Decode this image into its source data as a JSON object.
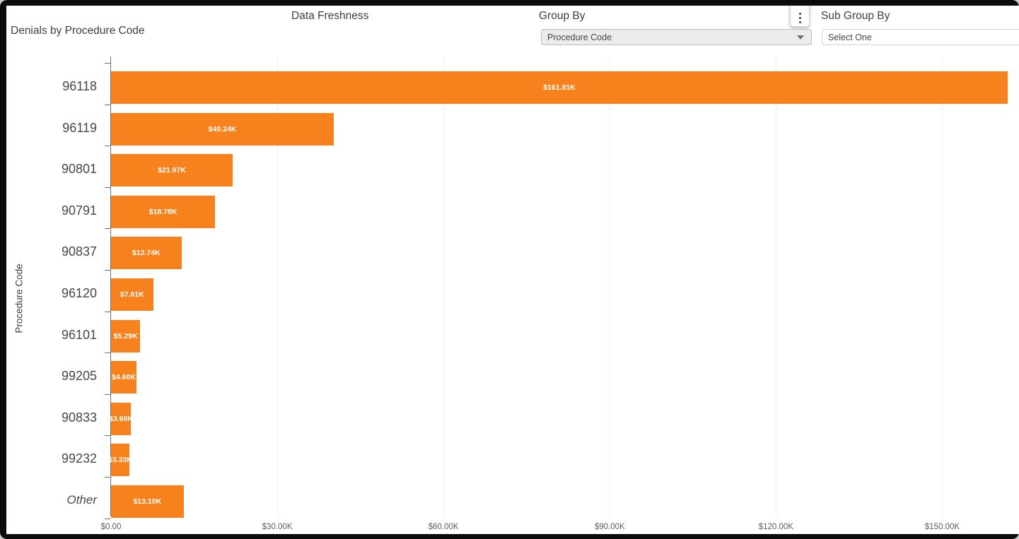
{
  "header": {
    "title": "Denials by Procedure Code",
    "data_freshness_label": "Data Freshness",
    "group_by_label": "Group By",
    "group_by_value": "Procedure Code",
    "sub_group_by_label": "Sub Group By",
    "sub_group_by_value": "Select One",
    "menu_icon": "kebab-menu-icon"
  },
  "chart_data": {
    "type": "bar",
    "orientation": "horizontal",
    "title": "Denials by Procedure Code",
    "xlabel": "",
    "ylabel": "Procedure Code",
    "xlim": [
      0,
      161810
    ],
    "grid": true,
    "bar_color": "#F7821D",
    "categories": [
      "96118",
      "96119",
      "90801",
      "90791",
      "90837",
      "96120",
      "96101",
      "99205",
      "90833",
      "99232",
      "Other"
    ],
    "values": [
      161810,
      40240,
      21970,
      18780,
      12740,
      7610,
      5290,
      4600,
      3600,
      3330,
      13100
    ],
    "data_labels": [
      "$161.81K",
      "$40.24K",
      "$21.97K",
      "$18.78K",
      "$12.74K",
      "$7.61K",
      "$5.29K",
      "$4.60K",
      "$3.60K",
      "$3.33K",
      "$13.10K"
    ],
    "xticks": [
      0,
      30000,
      60000,
      90000,
      120000,
      150000
    ],
    "xtick_labels": [
      "$0.00",
      "$30.00K",
      "$60.00K",
      "$90.00K",
      "$120.00K",
      "$150.00K"
    ]
  }
}
